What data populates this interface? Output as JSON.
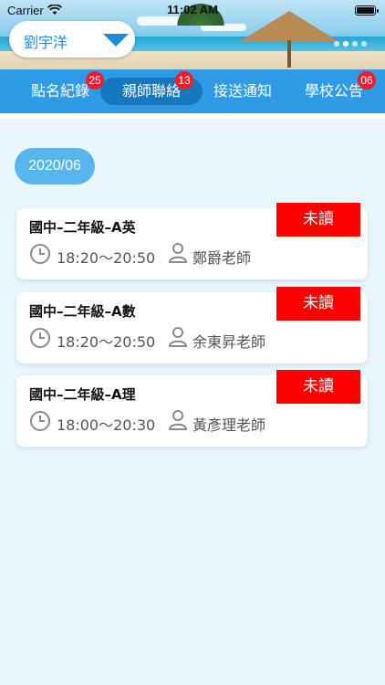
{
  "status_bar": {
    "carrier": "Carrier",
    "time": "11:02 AM"
  },
  "student_selector": {
    "name": "劉宇洋"
  },
  "tabs": [
    {
      "label": "點名紀錄",
      "badge": "25",
      "active": false
    },
    {
      "label": "親師聯絡",
      "badge": "13",
      "active": true
    },
    {
      "label": "接送通知",
      "badge": "",
      "active": false
    },
    {
      "label": "學校公告",
      "badge": "06",
      "active": false
    }
  ],
  "month": "2020/06",
  "messages": [
    {
      "title": "國中–二年級–A英",
      "time": "18:20～20:50",
      "teacher": "鄭爵老師",
      "status": "未讀"
    },
    {
      "title": "國中–二年級–A數",
      "time": "18:20～20:50",
      "teacher": "余東昇老師",
      "status": "未讀"
    },
    {
      "title": "國中–二年級–A理",
      "time": "18:00～20:30",
      "teacher": "黃彥理老師",
      "status": "未讀"
    }
  ],
  "colors": {
    "tabbar": "#2f9be7",
    "active_tab": "#1677bf",
    "badge": "#e9202a",
    "unread": "#ff0000",
    "month_chip": "#58b6ee",
    "background": "#e9f6fd"
  },
  "icons": {
    "status": [
      "wifi-icon",
      "battery-icon"
    ],
    "selector": "chevron-down-icon",
    "card": [
      "clock-icon",
      "person-icon"
    ]
  }
}
